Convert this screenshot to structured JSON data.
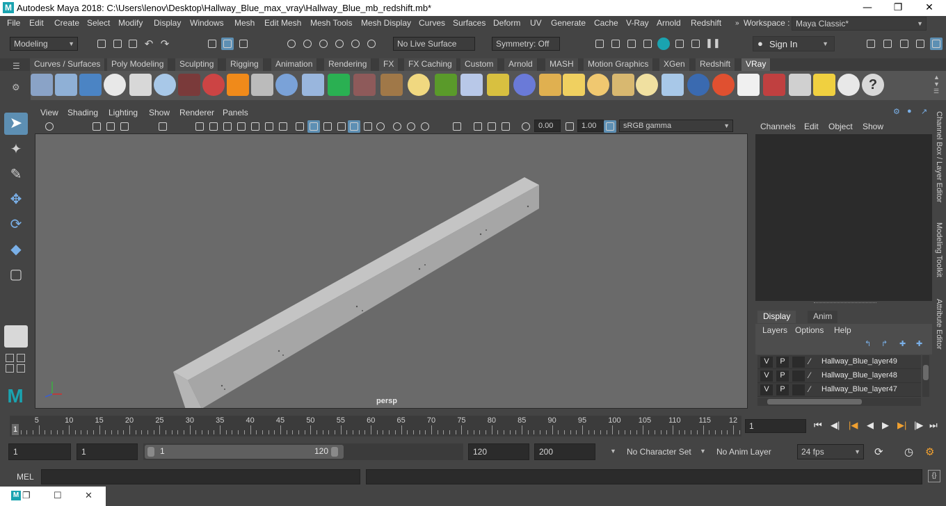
{
  "app": {
    "title": "Autodesk Maya 2018: C:\\Users\\lenov\\Desktop\\Hallway_Blue_max_vray\\Hallway_Blue_mb_redshift.mb*",
    "logo_letter": "M"
  },
  "menubar": {
    "items": [
      "File",
      "Edit",
      "Create",
      "Select",
      "Modify",
      "Display",
      "Windows",
      "Mesh",
      "Edit Mesh",
      "Mesh Tools",
      "Mesh Display",
      "Curves",
      "Surfaces",
      "Deform",
      "UV",
      "Generate",
      "Cache",
      "V-Ray",
      "Arnold",
      "Redshift"
    ],
    "workspace_label": "Workspace :",
    "workspace_value": "Maya Classic*"
  },
  "statusline": {
    "mode": "Modeling",
    "live_surface": "No Live Surface",
    "symmetry": "Symmetry: Off",
    "sign_in": "Sign In"
  },
  "shelf": {
    "tabs": [
      "Curves / Surfaces",
      "Poly Modeling",
      "Sculpting",
      "Rigging",
      "Animation",
      "Rendering",
      "FX",
      "FX Caching",
      "Custom",
      "Arnold",
      "MASH",
      "Motion Graphics",
      "XGen",
      "Redshift",
      "VRay"
    ],
    "active_tab": "VRay"
  },
  "panel": {
    "menu": [
      "View",
      "Shading",
      "Lighting",
      "Show",
      "Renderer",
      "Panels"
    ],
    "exposure": "0.00",
    "gamma": "1.00",
    "color_space": "sRGB gamma",
    "camera": "persp"
  },
  "channelbox": {
    "menu": [
      "Channels",
      "Edit",
      "Object",
      "Show"
    ]
  },
  "layer_editor": {
    "tabs": [
      "Display",
      "Anim"
    ],
    "active_tab": "Display",
    "menu": [
      "Layers",
      "Options",
      "Help"
    ],
    "layers": [
      {
        "v": "V",
        "p": "P",
        "name": "Hallway_Blue_layer49"
      },
      {
        "v": "V",
        "p": "P",
        "name": "Hallway_Blue_layer48"
      },
      {
        "v": "V",
        "p": "P",
        "name": "Hallway_Blue_layer47"
      }
    ]
  },
  "side_tabs": [
    "Channel Box / Layer Editor",
    "Modeling Toolkit",
    "Attribute Editor"
  ],
  "timeslider": {
    "labels": [
      "5",
      "10",
      "15",
      "20",
      "25",
      "30",
      "35",
      "40",
      "45",
      "50",
      "55",
      "60",
      "65",
      "70",
      "75",
      "80",
      "85",
      "90",
      "95",
      "100",
      "105",
      "110",
      "115",
      "12"
    ],
    "current_frame_marker": "1",
    "current_frame_field": "1"
  },
  "range": {
    "start": "1",
    "playback_start": "1",
    "slider_start": "1",
    "slider_end": "120",
    "playback_end": "120",
    "end": "200",
    "character_set": "No Character Set",
    "anim_layer": "No Anim Layer",
    "fps": "24 fps"
  },
  "cmdline": {
    "label": "MEL"
  }
}
